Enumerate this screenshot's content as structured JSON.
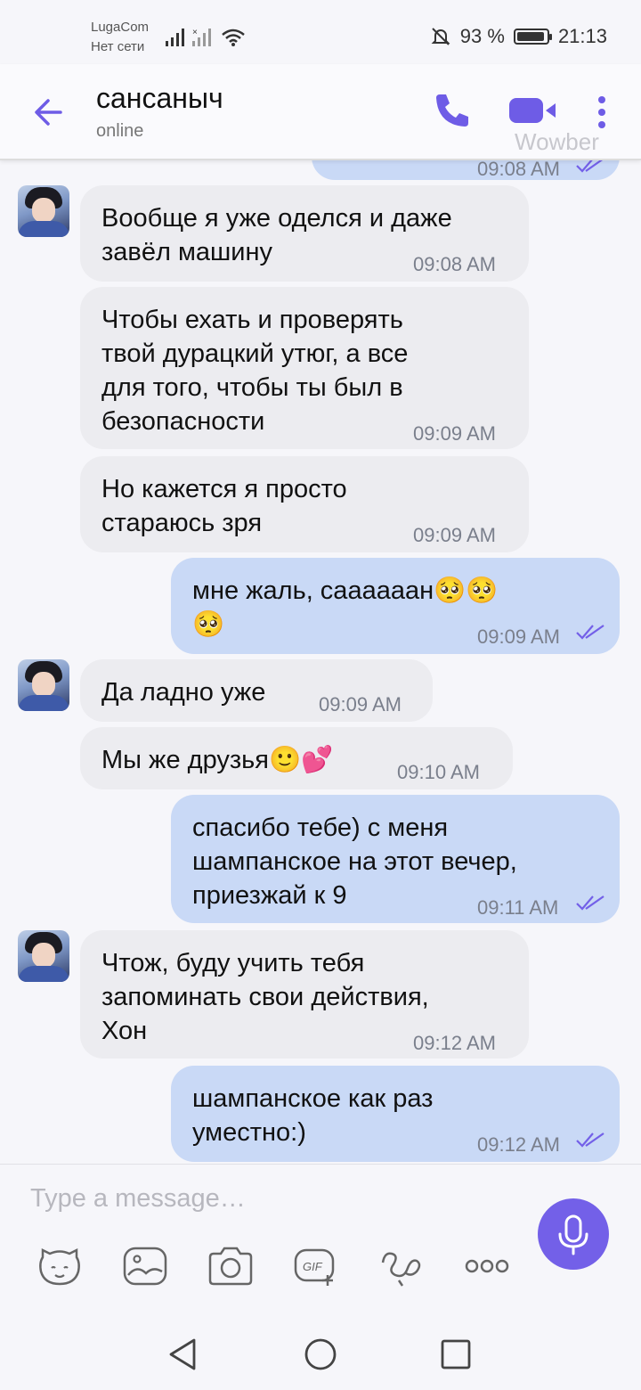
{
  "status": {
    "carrier": "LugaCom",
    "carrier_status": "Нет сети",
    "battery": "93 %",
    "battery_level": 0.93,
    "time": "21:13"
  },
  "header": {
    "name": "сансаныч",
    "presence": "online",
    "watermark": "Wowber"
  },
  "messages": [
    {
      "dir": "out",
      "text": "",
      "time": "09:08 AM"
    },
    {
      "dir": "in",
      "lines": [
        "Вообще я уже оделся и даже",
        "завёл машину"
      ],
      "time": "09:08 AM"
    },
    {
      "dir": "in",
      "lines": [
        "Чтобы ехать и проверять",
        "твой дурацкий утюг, а все",
        "для того, чтобы ты был в",
        "безопасности"
      ],
      "time": "09:09 AM"
    },
    {
      "dir": "in",
      "lines": [
        "Но кажется я просто",
        "стараюсь зря"
      ],
      "time": "09:09 AM"
    },
    {
      "dir": "out",
      "lines": [
        "мне жаль, саааааан🥺🥺",
        "🥺"
      ],
      "time": "09:09 AM"
    },
    {
      "dir": "in",
      "lines": [
        "Да ладно уже"
      ],
      "time": "09:09 AM"
    },
    {
      "dir": "in",
      "lines": [
        "Мы же друзья🙂💕"
      ],
      "time": "09:10 AM"
    },
    {
      "dir": "out",
      "lines": [
        "спасибо тебе) с меня",
        "шампанское на этот вечер,",
        "приезжай к 9"
      ],
      "time": "09:11 AM"
    },
    {
      "dir": "in",
      "lines": [
        "Чтож, буду учить тебя",
        "запоминать свои действия,",
        "Хон"
      ],
      "time": "09:12 AM"
    },
    {
      "dir": "out",
      "lines": [
        "шампанское как раз",
        "уместно:)"
      ],
      "time": "09:12 AM"
    }
  ],
  "composer": {
    "placeholder": "Type a message…",
    "tools": [
      "sticker-icon",
      "gallery-icon",
      "camera-icon",
      "gif-icon",
      "doodle-icon",
      "more-icon"
    ]
  },
  "colors": {
    "accent": "#7360e8",
    "incoming": "#ececf0",
    "outgoing": "#c9d9f6"
  }
}
